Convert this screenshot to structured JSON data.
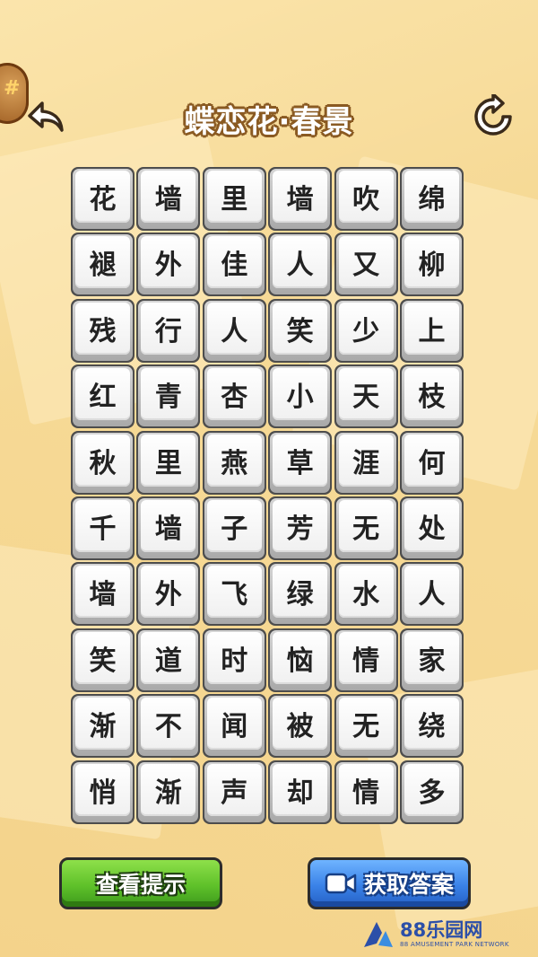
{
  "header": {
    "title": "蝶恋花·春景"
  },
  "icons": {
    "back": "back-arrow-icon",
    "restart": "restart-icon",
    "coin": "coin-badge-icon",
    "video": "video-camera-icon"
  },
  "grid": {
    "rows": [
      [
        "花",
        "墙",
        "里",
        "墙",
        "吹",
        "绵"
      ],
      [
        "褪",
        "外",
        "佳",
        "人",
        "又",
        "柳"
      ],
      [
        "残",
        "行",
        "人",
        "笑",
        "少",
        "上"
      ],
      [
        "红",
        "青",
        "杏",
        "小",
        "天",
        "枝"
      ],
      [
        "秋",
        "里",
        "燕",
        "草",
        "涯",
        "何"
      ],
      [
        "千",
        "墙",
        "子",
        "芳",
        "无",
        "处"
      ],
      [
        "墙",
        "外",
        "飞",
        "绿",
        "水",
        "人"
      ],
      [
        "笑",
        "道",
        "时",
        "恼",
        "情",
        "家"
      ],
      [
        "渐",
        "不",
        "闻",
        "被",
        "无",
        "绕"
      ],
      [
        "悄",
        "渐",
        "声",
        "却",
        "情",
        "多"
      ]
    ]
  },
  "buttons": {
    "hint_label": "查看提示",
    "answer_label": "获取答案"
  },
  "watermark": {
    "main": "88乐园网",
    "sub": "88 AMUSEMENT PARK NETWORK"
  },
  "colors": {
    "background": "#f6d995",
    "title_outline": "#8a5a22",
    "hint_button": "#5fc12a",
    "answer_button": "#3a82e8"
  }
}
